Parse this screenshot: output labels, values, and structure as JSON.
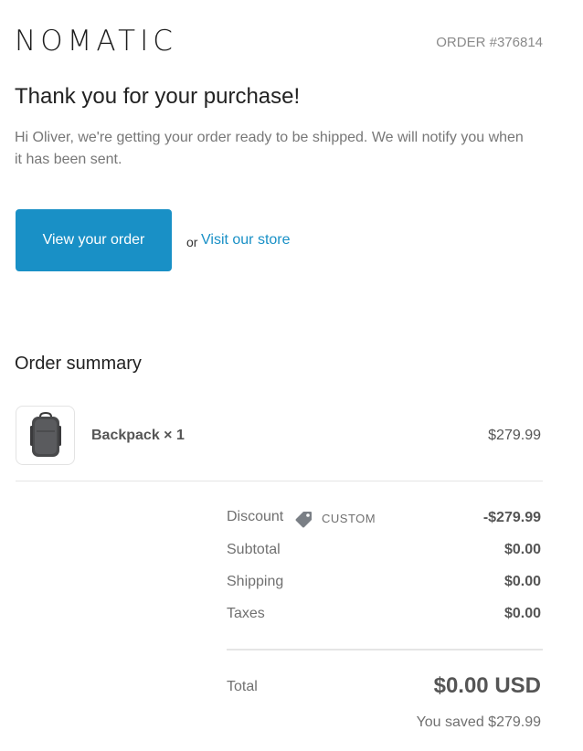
{
  "header": {
    "logo": "NOMATIC",
    "order_number": "ORDER #376814"
  },
  "message": {
    "title": "Thank you for your purchase!",
    "body": "Hi Oliver, we're getting your order ready to be shipped. We will notify you when it has been sent."
  },
  "actions": {
    "view_order": "View your order",
    "or": "or",
    "visit_store": "Visit our store"
  },
  "summary": {
    "title": "Order summary",
    "item": {
      "name": "Backpack × 1",
      "price": "$279.99",
      "icon": "backpack-icon"
    },
    "discount": {
      "label": "Discount",
      "code": "CUSTOM",
      "value": "-$279.99",
      "icon": "tag-icon"
    },
    "subtotal": {
      "label": "Subtotal",
      "value": "$0.00"
    },
    "shipping": {
      "label": "Shipping",
      "value": "$0.00"
    },
    "taxes": {
      "label": "Taxes",
      "value": "$0.00"
    },
    "total": {
      "label": "Total",
      "value": "$0.00 USD"
    },
    "saved": "You saved $279.99"
  },
  "colors": {
    "accent": "#1990c6",
    "text_dark": "#222222",
    "text_muted": "#707070"
  }
}
